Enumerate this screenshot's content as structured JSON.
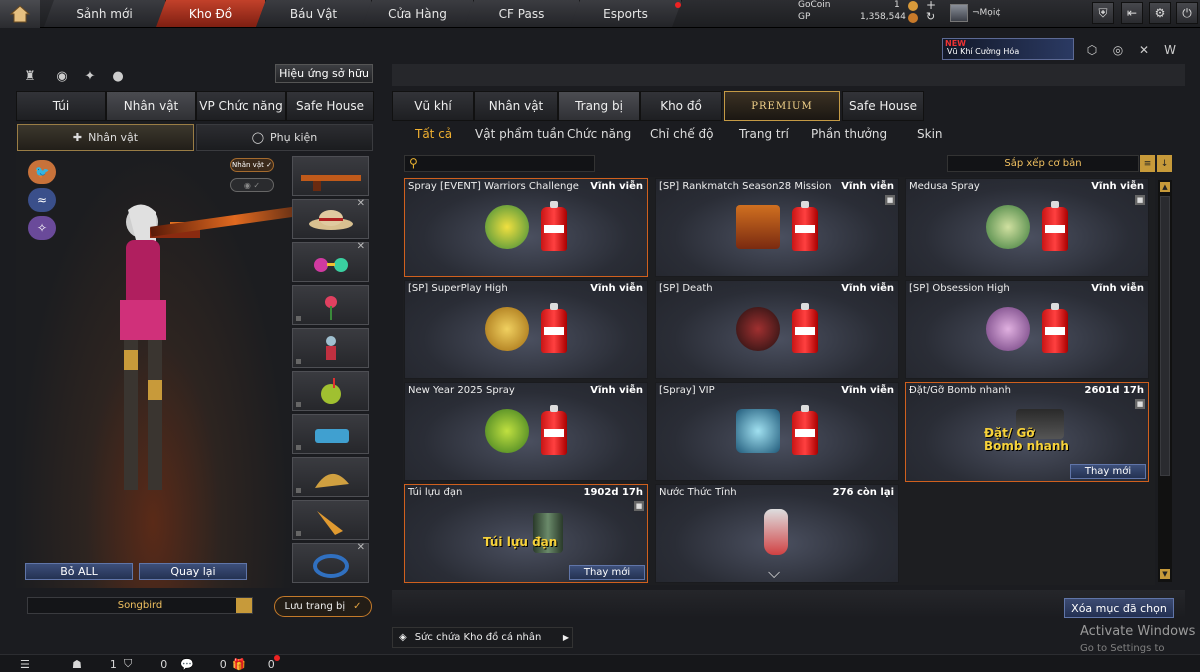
{
  "nav": {
    "tabs": [
      "Sảnh mới",
      "Kho Đồ",
      "Báu Vật",
      "Cửa Hàng",
      "CF Pass",
      "Esports"
    ],
    "active_tab": "Kho Đồ"
  },
  "currency": {
    "gocoin_label": "GoCoin",
    "gocoin_value": "1",
    "gp_label": "GP",
    "gp_value": "1,358,544"
  },
  "profile": {
    "name": "¬Mọi¢"
  },
  "promo": {
    "badge": "NEW",
    "text": "Vũ Khí Cường Hóa"
  },
  "left": {
    "effect_button": "Hiệu ứng sở hữu",
    "tabs": [
      "Túi",
      "Nhân vật",
      "VP Chức năng",
      "Safe House"
    ],
    "active_tab": "Nhân vật",
    "subtabs": [
      "Nhân vật",
      "Phụ kiện"
    ],
    "badge_char": "Nhân vật ✓",
    "reset_all": "Bỏ ALL",
    "back": "Quay lại",
    "preset_name": "Songbird",
    "save": "Lưu trang bị"
  },
  "right": {
    "tabs": [
      "Vũ khí",
      "Nhân vật",
      "Trang bị",
      "Kho đồ",
      "PREMIUM",
      "Safe House"
    ],
    "active_tab": "Trang bị",
    "filters": [
      "Tất cả",
      "Vật phẩm tuần",
      "Chức năng",
      "Chỉ chế độ",
      "Trang trí",
      "Phần thưởng",
      "Skin"
    ],
    "active_filter": "Tất cả",
    "sort_label": "Sắp xếp cơ bản",
    "items": [
      {
        "name": "Spray [EVENT] Warriors Challenge",
        "duration": "Vĩnh viễn",
        "art": "warriors"
      },
      {
        "name": "[SP] Rankmatch Season28 Mission",
        "duration": "Vĩnh viễn",
        "art": "rank"
      },
      {
        "name": "Medusa Spray",
        "duration": "Vĩnh viễn",
        "art": "medusa"
      },
      {
        "name": "[SP] SuperPlay High",
        "duration": "Vĩnh viễn",
        "art": "superplay"
      },
      {
        "name": "[SP] Death",
        "duration": "Vĩnh viễn",
        "art": "death"
      },
      {
        "name": "[SP] Obsession High",
        "duration": "Vĩnh viễn",
        "art": "obsession"
      },
      {
        "name": "New Year 2025 Spray",
        "duration": "Vĩnh viễn",
        "art": "newyear"
      },
      {
        "name": "[Spray] VIP",
        "duration": "Vĩnh viễn",
        "art": "vip"
      },
      {
        "name": "Đặt/Gỡ Bomb nhanh",
        "duration": "2601d 17h",
        "caption": "Đặt/ Gỡ Bomb nhanh",
        "change": "Thay mới"
      },
      {
        "name": "Túi lựu đạn",
        "duration": "1902d 17h",
        "caption": "Túi lựu đạn",
        "change": "Thay mới"
      },
      {
        "name": "Nước Thức Tỉnh",
        "duration": "276 còn lại"
      }
    ],
    "delete_button": "Xóa mục đã chọn",
    "capacity": "Sức chứa Kho đồ cá nhân"
  },
  "watermark": {
    "title": "Activate Windows",
    "sub": "Go to Settings to activate"
  },
  "footer": {
    "count1": "1",
    "count2": "0",
    "count3": "0",
    "count4": "0"
  },
  "colors": {
    "accent": "#c2412a",
    "gold": "#f0b030",
    "button_blue": "#2f3f66"
  }
}
